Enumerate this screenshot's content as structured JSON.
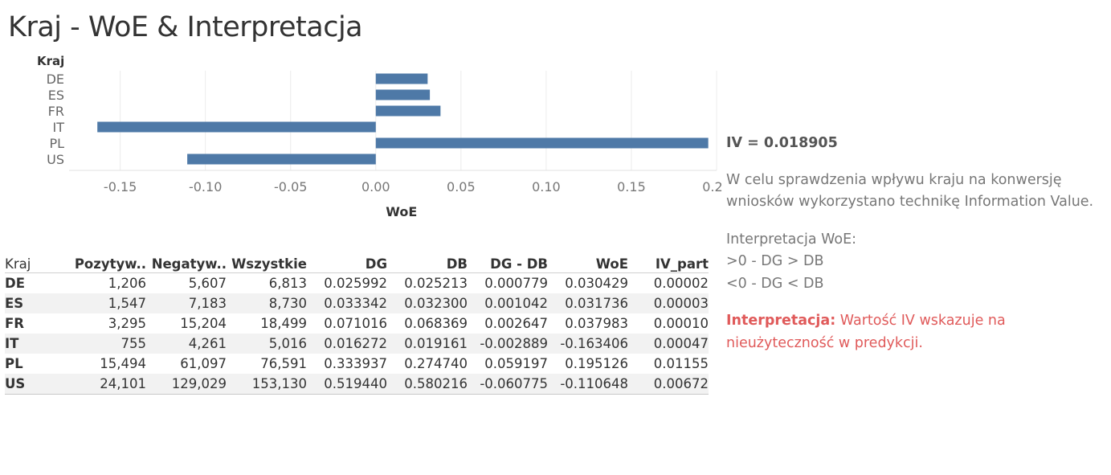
{
  "title": "Kraj - WoE & Interpretacja",
  "chart_data": {
    "type": "bar",
    "orientation": "horizontal",
    "row_header": "Kraj",
    "categories": [
      "DE",
      "ES",
      "FR",
      "IT",
      "PL",
      "US"
    ],
    "values": [
      0.030429,
      0.031736,
      0.037983,
      -0.163406,
      0.195126,
      -0.110648
    ],
    "xlabel": "WoE",
    "xlim": [
      -0.18,
      0.2
    ],
    "xticks": [
      -0.15,
      -0.1,
      -0.05,
      0.0,
      0.05,
      0.1,
      0.15,
      0.2
    ],
    "xtick_labels": [
      "-0.15",
      "-0.10",
      "-0.05",
      "0.00",
      "0.05",
      "0.10",
      "0.15",
      "0.20"
    ],
    "bar_color": "#4e79a7",
    "grid": true
  },
  "table": {
    "headers": [
      "Kraj",
      "Pozytyw..",
      "Negatyw..",
      "Wszystkie",
      "DG",
      "DB",
      "DG - DB",
      "WoE",
      "IV_part"
    ],
    "rows": [
      [
        "DE",
        "1,206",
        "5,607",
        "6,813",
        "0.025992",
        "0.025213",
        "0.000779",
        "0.030429",
        "0.00002"
      ],
      [
        "ES",
        "1,547",
        "7,183",
        "8,730",
        "0.033342",
        "0.032300",
        "0.001042",
        "0.031736",
        "0.00003"
      ],
      [
        "FR",
        "3,295",
        "15,204",
        "18,499",
        "0.071016",
        "0.068369",
        "0.002647",
        "0.037983",
        "0.00010"
      ],
      [
        "IT",
        "755",
        "4,261",
        "5,016",
        "0.016272",
        "0.019161",
        "-0.002889",
        "-0.163406",
        "0.00047"
      ],
      [
        "PL",
        "15,494",
        "61,097",
        "76,591",
        "0.333937",
        "0.274740",
        "0.059197",
        "0.195126",
        "0.01155"
      ],
      [
        "US",
        "24,101",
        "129,029",
        "153,130",
        "0.519440",
        "0.580216",
        "-0.060775",
        "-0.110648",
        "0.00672"
      ]
    ]
  },
  "side": {
    "iv": "IV = 0.018905",
    "description": "W celu sprawdzenia wpływu kraju na konwersję wniosków wykorzystano technikę Information Value.",
    "woe_title": "Interpretacja WoE:",
    "woe_pos": ">0 - DG > DB",
    "woe_neg": "<0 - DG < DB",
    "interp_label": "Interpretacja:",
    "interp_text": " Wartość IV wskazuje na nieużyteczność w predykcji.",
    "interp_color": "#e05a5a"
  }
}
